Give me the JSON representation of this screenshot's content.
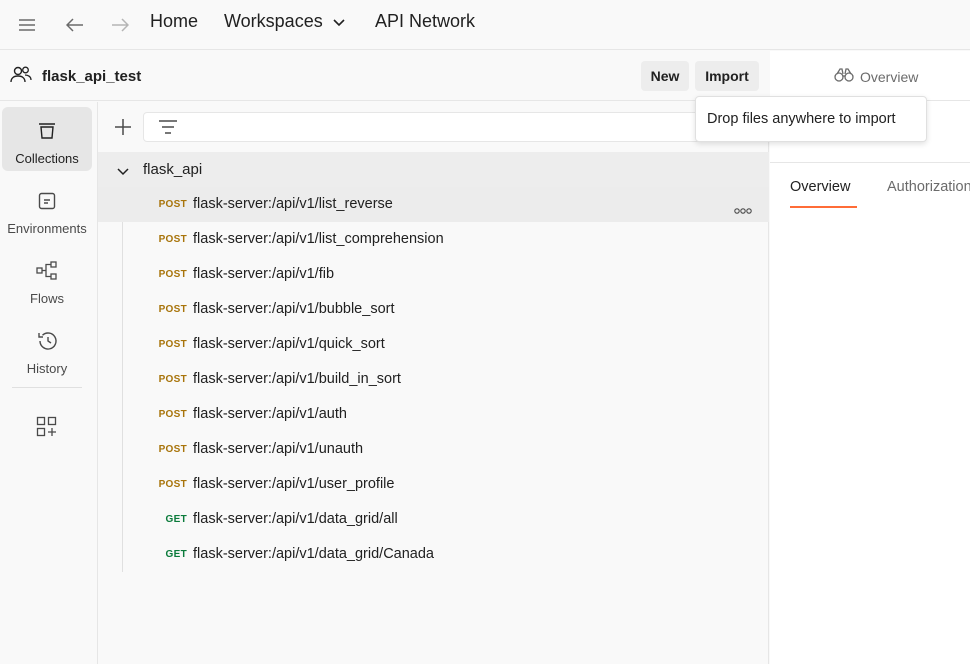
{
  "topbar": {
    "home": "Home",
    "workspaces": "Workspaces",
    "api_network": "API Network"
  },
  "workspace": {
    "name": "flask_api_test",
    "new_label": "New",
    "import_label": "Import"
  },
  "sidebar": {
    "items": [
      {
        "label": "Collections",
        "icon": "collections-icon"
      },
      {
        "label": "Environments",
        "icon": "environments-icon"
      },
      {
        "label": "Flows",
        "icon": "flows-icon"
      },
      {
        "label": "History",
        "icon": "history-icon"
      }
    ],
    "configure_icon": "configure-workbench-icon"
  },
  "collection": {
    "name": "flask_api",
    "requests": [
      {
        "method": "POST",
        "name": "flask-server:/api/v1/list_reverse"
      },
      {
        "method": "POST",
        "name": "flask-server:/api/v1/list_comprehension"
      },
      {
        "method": "POST",
        "name": "flask-server:/api/v1/fib"
      },
      {
        "method": "POST",
        "name": "flask-server:/api/v1/bubble_sort"
      },
      {
        "method": "POST",
        "name": "flask-server:/api/v1/quick_sort"
      },
      {
        "method": "POST",
        "name": "flask-server:/api/v1/build_in_sort"
      },
      {
        "method": "POST",
        "name": "flask-server:/api/v1/auth"
      },
      {
        "method": "POST",
        "name": "flask-server:/api/v1/unauth"
      },
      {
        "method": "POST",
        "name": "flask-server:/api/v1/user_profile"
      },
      {
        "method": "GET",
        "name": "flask-server:/api/v1/data_grid/all"
      },
      {
        "method": "GET",
        "name": "flask-server:/api/v1/data_grid/Canada"
      }
    ]
  },
  "right_pane": {
    "title": "Overview",
    "tabs": [
      "Overview",
      "Authorization"
    ]
  },
  "tooltip": {
    "text": "Drop files anywhere to import"
  },
  "colors": {
    "post": "#a8740b",
    "get": "#0b7b3b",
    "accent": "#ff6c37"
  }
}
